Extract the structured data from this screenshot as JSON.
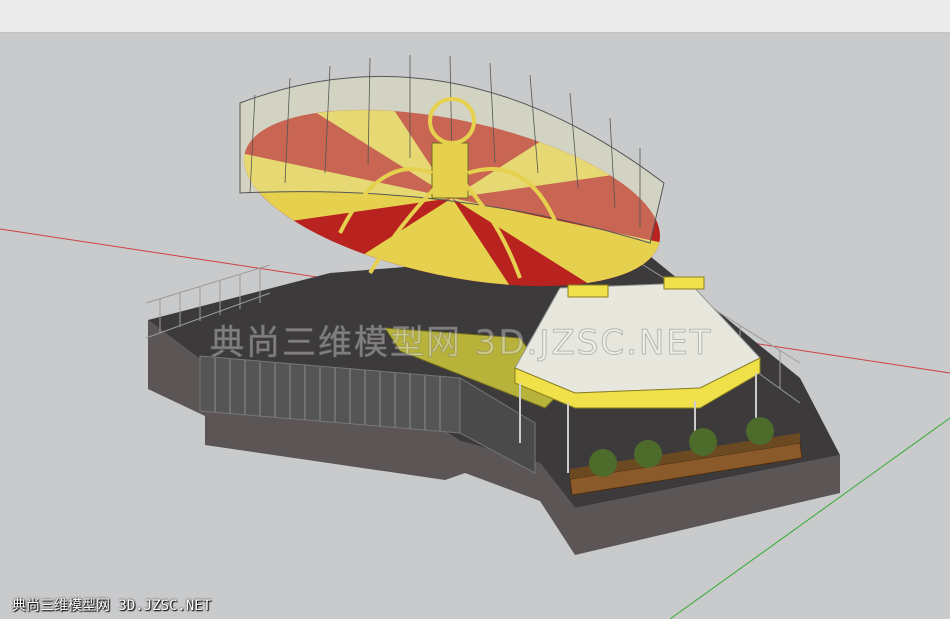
{
  "watermark": {
    "center_text": "典尚三维模型网 3D.JZSC.NET",
    "corner_text": "典尚三维模型网 3D.JZSC.NET"
  },
  "scene": {
    "subject": "amusement-ride-3d-model",
    "colors": {
      "background": "#c9cacc",
      "canopy_red": "#b8231f",
      "canopy_yellow": "#e6d14f",
      "platform_dark": "#3d3a3c",
      "base_side": "#5b5556",
      "fence": "#9a9a9a",
      "pavilion_roof": "#e7e7dd",
      "pavilion_trim": "#f0e04a",
      "red_axis": "#d04040",
      "green_axis": "#33aa33"
    }
  }
}
